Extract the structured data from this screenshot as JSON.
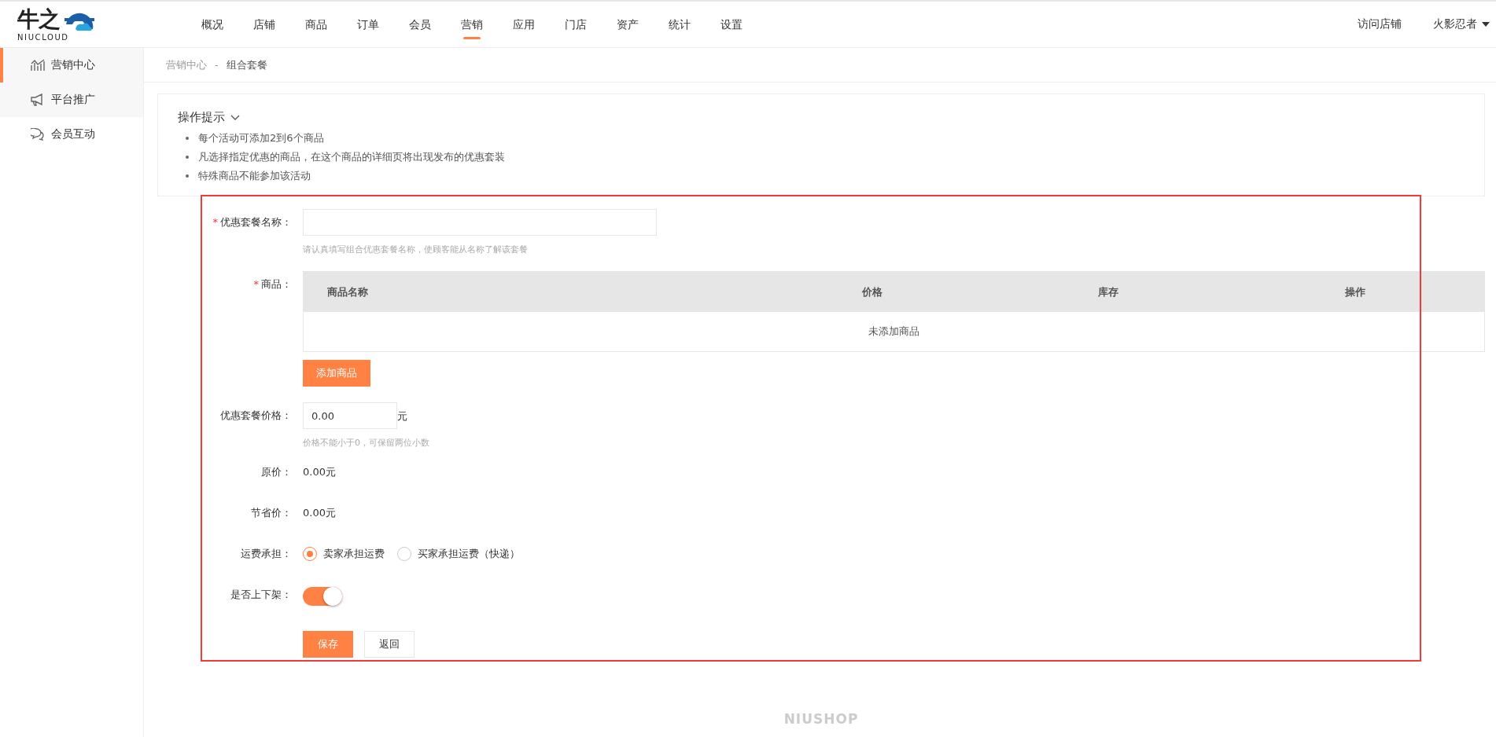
{
  "logo": {
    "mark": "牛之",
    "wordmark": "NIUCLOUD"
  },
  "nav": [
    {
      "label": "概况",
      "selected": false
    },
    {
      "label": "店铺",
      "selected": false
    },
    {
      "label": "商品",
      "selected": false
    },
    {
      "label": "订单",
      "selected": false
    },
    {
      "label": "会员",
      "selected": false
    },
    {
      "label": "营销",
      "selected": true
    },
    {
      "label": "应用",
      "selected": false
    },
    {
      "label": "门店",
      "selected": false
    },
    {
      "label": "资产",
      "selected": false
    },
    {
      "label": "统计",
      "selected": false
    },
    {
      "label": "设置",
      "selected": false
    }
  ],
  "header_links": {
    "visit_store": "访问店铺",
    "user": "火影忍者"
  },
  "sidebar": {
    "items": [
      {
        "label": "营销中心",
        "kind": "chart",
        "selected": true
      },
      {
        "label": "平台推广",
        "kind": "megaphone",
        "selected": false
      },
      {
        "label": "会员互动",
        "kind": "chat",
        "selected": false
      }
    ]
  },
  "breadcrumb": [
    "营销中心",
    "组合套餐"
  ],
  "breadcrumb_separator": "-",
  "tips": {
    "title": "操作提示",
    "items": [
      "每个活动可添加2到6个商品",
      "凡选择指定优惠的商品，在这个商品的详细页将出现发布的优惠套装",
      "特殊商品不能参加该活动"
    ]
  },
  "form": {
    "name": {
      "label": "优惠套餐名称：",
      "required_mark": "*",
      "hint": "请认真填写组合优惠套餐名称，使顾客能从名称了解该套餐"
    },
    "goods": {
      "label": "商品：",
      "required_mark": "*",
      "columns": [
        "商品名称",
        "价格",
        "库存",
        "操作"
      ],
      "empty": "未添加商品",
      "add_button": "添加商品"
    },
    "price": {
      "label": "优惠套餐价格：",
      "value": "0.00",
      "unit": "元",
      "hint": "价格不能小于0，可保留两位小数"
    },
    "original": {
      "label": "原价：",
      "value": "0.00元"
    },
    "saving": {
      "label": "节省价：",
      "value": "0.00元"
    },
    "shipping": {
      "label": "运费承担：",
      "options": [
        {
          "label": "卖家承担运费",
          "selected": true
        },
        {
          "label": "买家承担运费（快递）",
          "selected": false
        }
      ]
    },
    "listed": {
      "label": "是否上下架：",
      "on": true
    },
    "buttons": [
      {
        "label": "保存",
        "kind": "primary"
      },
      {
        "label": "返回",
        "kind": "default"
      }
    ]
  },
  "footer": "NIUSHOP"
}
